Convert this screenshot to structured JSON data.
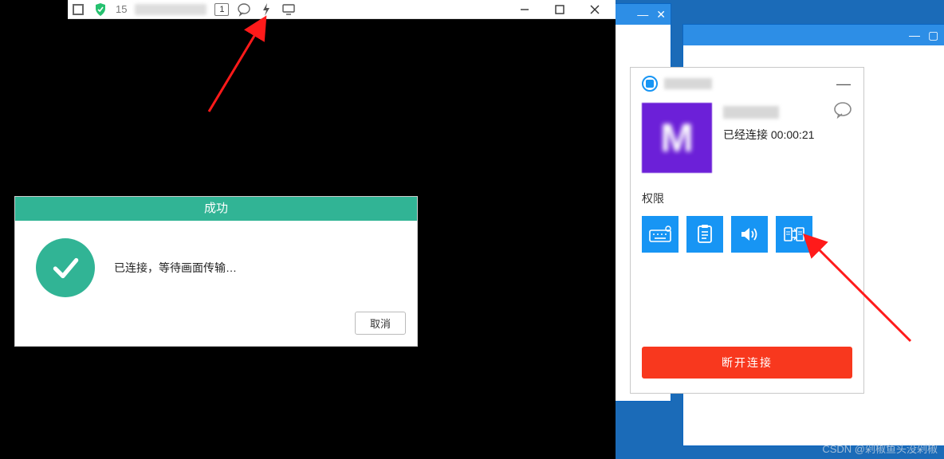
{
  "left": {
    "toolbar": {
      "device_id_prefix": "15",
      "badge_count": "1"
    },
    "dialog": {
      "title": "成功",
      "message": "已连接，等待画面传输…",
      "cancel": "取消"
    }
  },
  "right": {
    "popup": {
      "connected_label": "已经连接",
      "duration": "00:00:21",
      "permissions_label": "权限",
      "disconnect": "断开连接"
    },
    "watermark": "CSDN @剁椒鱼头没剁椒"
  }
}
